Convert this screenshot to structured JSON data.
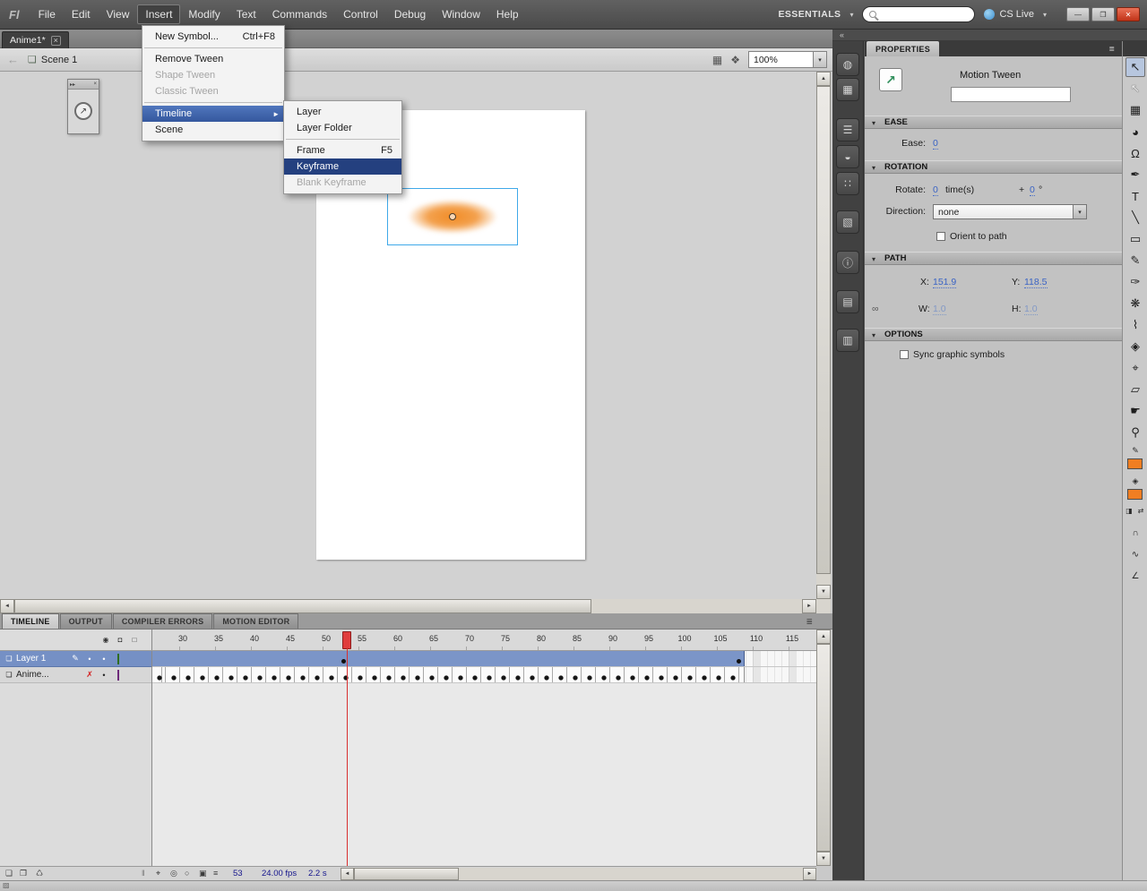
{
  "window": {
    "logo": "Fl",
    "workspace": "ESSENTIALS",
    "cs_live": "CS Live",
    "minimize": "—",
    "restore": "❐",
    "close": "✕",
    "dropdown_glyph": "▾",
    "collapse_dock_glyph": "«",
    "panel_menu_glyph": "≣"
  },
  "scroll": {
    "up": "▲",
    "down": "▼",
    "left": "◄",
    "right": "►"
  },
  "menubar": {
    "items": [
      "File",
      "Edit",
      "View",
      "Insert",
      "Modify",
      "Text",
      "Commands",
      "Control",
      "Debug",
      "Window",
      "Help"
    ],
    "active_item": "Insert"
  },
  "doc_tab": {
    "title": "Anime1*",
    "close": "×"
  },
  "edit_bar": {
    "back": "←",
    "scene_icon": "❏",
    "scene": "Scene 1",
    "edit_scene_icon": "▦",
    "edit_symbols_icon": "❖",
    "zoom": "100%"
  },
  "mini_panel": {
    "collapse": "▸▸",
    "close": "×",
    "icon": "↗"
  },
  "insert_menu": {
    "new_symbol": "New Symbol...",
    "new_symbol_shortcut": "Ctrl+F8",
    "remove_tween": "Remove Tween",
    "shape_tween": "Shape Tween",
    "classic_tween": "Classic Tween",
    "timeline": "Timeline",
    "submenu_arrow": "►",
    "scene": "Scene"
  },
  "timeline_submenu": {
    "layer": "Layer",
    "layer_folder": "Layer Folder",
    "frame": "Frame",
    "frame_shortcut": "F5",
    "keyframe": "Keyframe",
    "blank_keyframe": "Blank Keyframe"
  },
  "timeline": {
    "tabs": [
      "TIMELINE",
      "OUTPUT",
      "COMPILER ERRORS",
      "MOTION EDITOR"
    ],
    "active_tab": "TIMELINE",
    "ruler": [
      "30",
      "35",
      "40",
      "45",
      "50",
      "55",
      "60",
      "65",
      "70",
      "75",
      "80",
      "85",
      "90",
      "95",
      "100",
      "105",
      "110",
      "115"
    ],
    "layers": [
      {
        "name": "Layer 1"
      },
      {
        "name": "Anime..."
      }
    ],
    "current_frame": "53",
    "frame_rate": "24.00 fps",
    "elapsed": "2.2 s",
    "eye_glyph": "◉",
    "lock_glyph": "◘",
    "outline_glyph": "□",
    "page_icon": "❏",
    "pencil_glyph": "✎",
    "dot": "•",
    "hidden_glyph": "✗",
    "handle": "‖",
    "new_layer_glyph": "❏",
    "new_folder_glyph": "❐",
    "delete_glyph": "♺",
    "center_frame_glyph": "⌖",
    "onion_glyph": "◎",
    "onion_outline_glyph": "○",
    "edit_multi_glyph": "▣",
    "markers_glyph": "≡"
  },
  "status": {
    "grip": "▨"
  },
  "dock": {
    "icons": [
      {
        "name": "color",
        "glyph": "◍"
      },
      {
        "name": "swatches",
        "glyph": "▦"
      },
      {
        "name": "align",
        "glyph": "☰"
      },
      {
        "name": "color-mixer",
        "glyph": "◒"
      },
      {
        "name": "samples",
        "glyph": "∷"
      },
      {
        "name": "transform",
        "glyph": "▧"
      },
      {
        "name": "info",
        "glyph": "ⓘ"
      },
      {
        "name": "code-snippets",
        "glyph": "▤"
      },
      {
        "name": "library",
        "glyph": "▥"
      }
    ]
  },
  "properties": {
    "tab": "PROPERTIES",
    "tween_icon": "↗",
    "tween_label": "Motion Tween",
    "name_value": "",
    "ease": {
      "title": "EASE",
      "label": "Ease:",
      "value": "0"
    },
    "rotation": {
      "title": "ROTATION",
      "rotate_label": "Rotate:",
      "count": "0",
      "count_unit": "time(s)",
      "plus": "+",
      "angle": "0",
      "degree": "°",
      "direction_label": "Direction:",
      "direction_value": "none",
      "orient": "Orient to path"
    },
    "path": {
      "title": "PATH",
      "link_glyph": "∞",
      "x_label": "X:",
      "x": "151.9",
      "y_label": "Y:",
      "y": "118.5",
      "w_label": "W:",
      "w": "1.0",
      "h_label": "H:",
      "h": "1.0"
    },
    "options": {
      "title": "OPTIONS",
      "sync": "Sync graphic symbols"
    }
  },
  "tools": {
    "items": [
      {
        "name": "selection",
        "glyph": "↖"
      },
      {
        "name": "subselection",
        "glyph": "↖"
      },
      {
        "name": "free-transform",
        "glyph": "▦"
      },
      {
        "name": "3d-rotation",
        "glyph": "◕"
      },
      {
        "name": "lasso",
        "glyph": "Ω"
      },
      {
        "name": "pen",
        "glyph": "✒"
      },
      {
        "name": "text",
        "glyph": "T"
      },
      {
        "name": "line",
        "glyph": "╲"
      },
      {
        "name": "rectangle",
        "glyph": "▭"
      },
      {
        "name": "pencil",
        "glyph": "✎"
      },
      {
        "name": "brush",
        "glyph": "✑"
      },
      {
        "name": "deco",
        "glyph": "❋"
      },
      {
        "name": "bone",
        "glyph": "⌇"
      },
      {
        "name": "paint-bucket",
        "glyph": "◈"
      },
      {
        "name": "eyedropper",
        "glyph": "⌖"
      },
      {
        "name": "eraser",
        "glyph": "▱"
      },
      {
        "name": "hand",
        "glyph": "☛"
      },
      {
        "name": "zoom",
        "glyph": "⚲"
      }
    ],
    "stroke_icon": "✎",
    "fill_icon": "◈",
    "bw_glyph": "◨",
    "swap_glyph": "⇄",
    "magnet_glyph": "∩",
    "smooth_glyph": "∿",
    "straighten_glyph": "∠"
  },
  "colors": {
    "accent_orange": "#f07e22",
    "selection_blue": "#3fa9e9",
    "tween_blue": "#7b95c8",
    "menu_highlight": "#35589e",
    "submenu_highlight": "#24407f",
    "hot_text_blue": "#3a63c4"
  }
}
